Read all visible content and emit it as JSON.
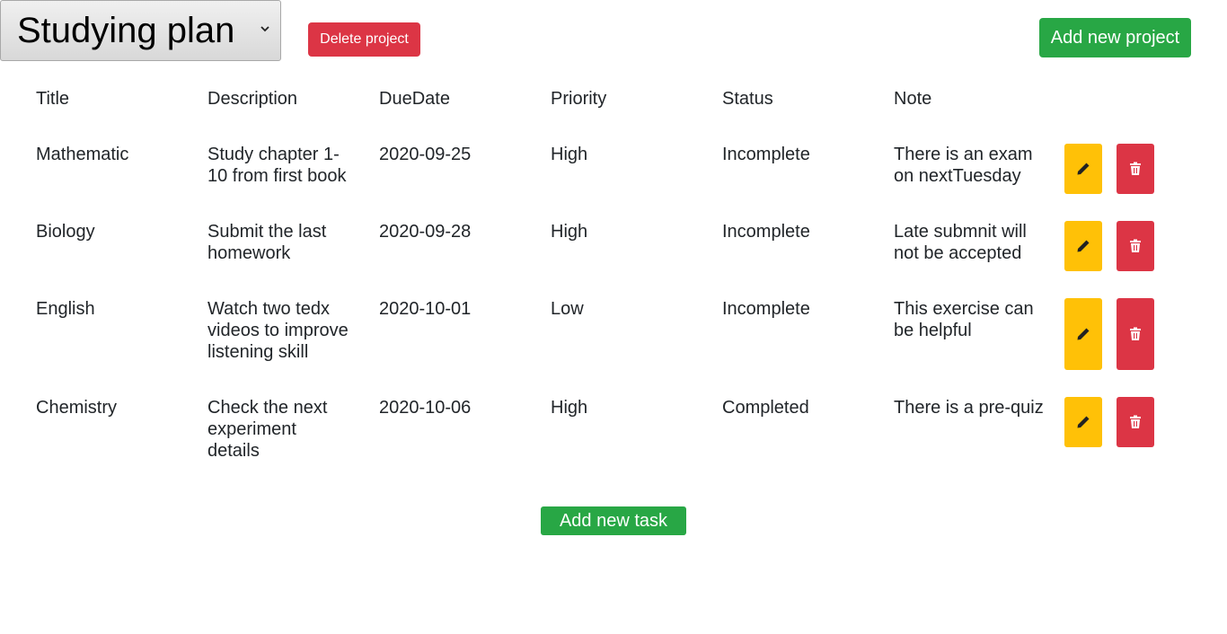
{
  "project": {
    "selected": "Studying plan",
    "delete_label": "Delete project",
    "add_label": "Add new project"
  },
  "table": {
    "headers": [
      "Title",
      "Description",
      "DueDate",
      "Priority",
      "Status",
      "Note"
    ],
    "rows": [
      {
        "title": "Mathematic",
        "description": "Study chapter 1-10 from first book",
        "due": "2020-09-25",
        "priority": "High",
        "status": "Incomplete",
        "note": "There is an exam on nextTuesday"
      },
      {
        "title": "Biology",
        "description": "Submit the last homework",
        "due": "2020-09-28",
        "priority": "High",
        "status": "Incomplete",
        "note": "Late submnit will not be accepted"
      },
      {
        "title": "English",
        "description": "Watch two tedx videos to improve listening skill",
        "due": "2020-10-01",
        "priority": "Low",
        "status": "Incomplete",
        "note": "This exercise can be helpful"
      },
      {
        "title": "Chemistry",
        "description": "Check the next experiment details",
        "due": "2020-10-06",
        "priority": "High",
        "status": "Completed",
        "note": "There is a pre-quiz"
      }
    ],
    "row_actions": {
      "edit_icon": "pencil-icon",
      "delete_icon": "trash-icon"
    }
  },
  "add_task_label": "Add new task",
  "colors": {
    "success": "#28a745",
    "danger": "#dc3545",
    "warning": "#ffc107"
  }
}
